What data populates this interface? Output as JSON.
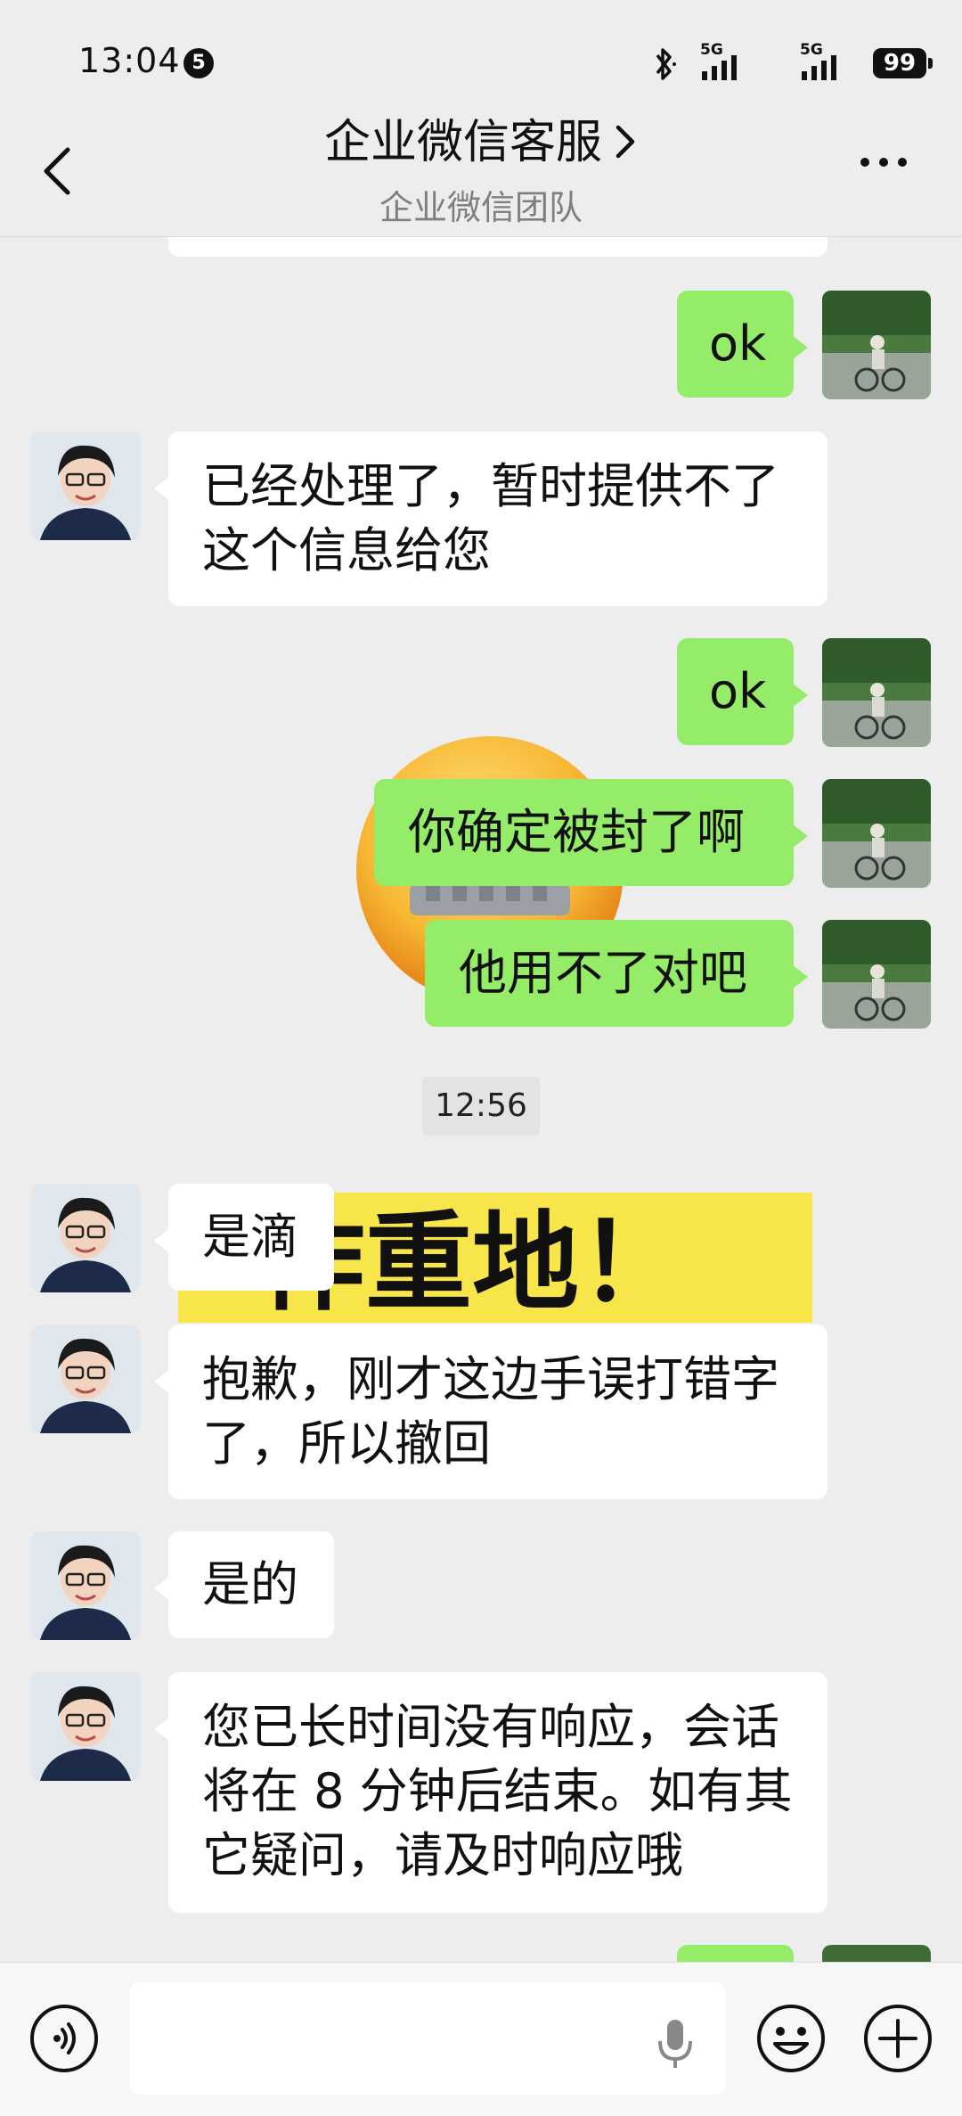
{
  "status_bar": {
    "time": "13:04",
    "notification_count": "5",
    "network_1": "5G",
    "network_2": "5G",
    "battery": "99"
  },
  "header": {
    "title": "企业微信客服",
    "subtitle": "企业微信团队"
  },
  "messages": [
    {
      "side": "me",
      "text": "ok"
    },
    {
      "side": "other",
      "line1": "已经处理了，暂时提供不了",
      "line2": "这个信息给您"
    },
    {
      "side": "me",
      "text": "ok"
    },
    {
      "side": "me",
      "text": "你确定被封了啊"
    },
    {
      "side": "me",
      "text": "他用不了对吧"
    },
    {
      "side": "other",
      "text": "是滴"
    },
    {
      "side": "other",
      "line1": "抱歉，刚才这边手误打错字",
      "line2": "了，所以撤回"
    },
    {
      "side": "other",
      "text": "是的"
    },
    {
      "side": "other",
      "line1": "您已长时间没有响应，会话",
      "line2": "将在 8 分钟后结束。如有其",
      "line3": "它疑问，请及时响应哦"
    }
  ],
  "timestamp": "12:56",
  "background_sticker_text": "作重地！",
  "colors": {
    "my_bubble": "#95ec69",
    "other_bubble": "#ffffff",
    "background": "#ededed"
  }
}
